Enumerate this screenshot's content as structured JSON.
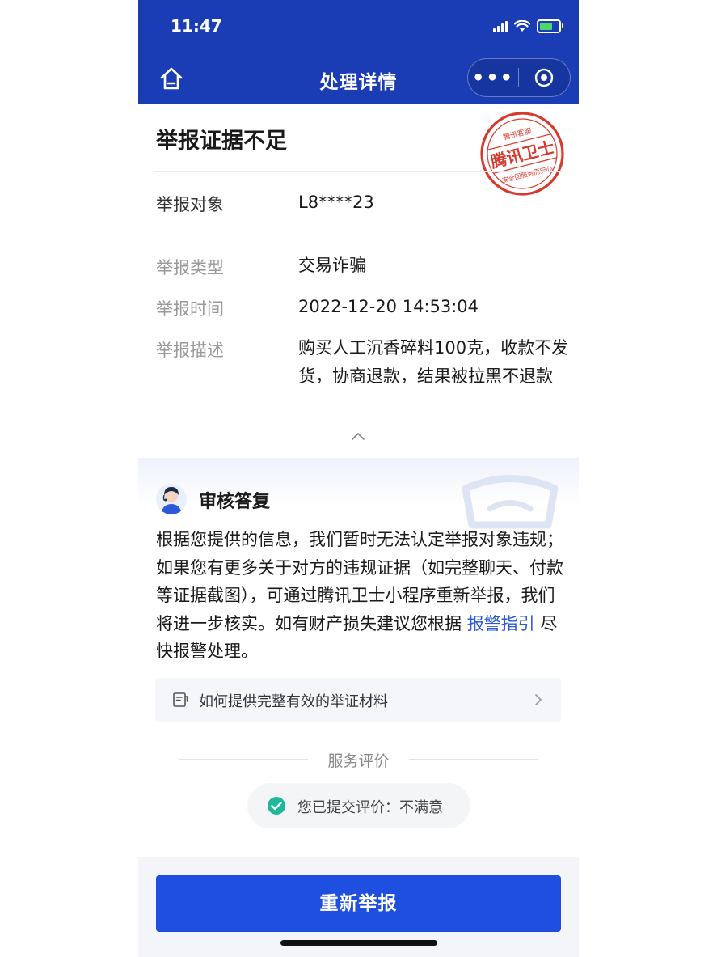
{
  "status_bar": {
    "time": "11:47",
    "battery_level": 0.85,
    "battery_color": "#4cd964"
  },
  "nav": {
    "title": "处理详情",
    "more_label": "•••"
  },
  "report": {
    "title": "举报证据不足",
    "stamp": {
      "main_text": "腾讯卫士",
      "top_text": "腾讯客服",
      "bottom_text": "安全回服务而安心",
      "color": "#d9382c"
    },
    "target_label": "举报对象",
    "target_value": "L8****23",
    "type_label": "举报类型",
    "type_value": "交易诈骗",
    "time_label": "举报时间",
    "time_value": "2022-12-20 14:53:04",
    "desc_label": "举报描述",
    "desc_value": "购买人工沉香碎料100克，收款不发货，协商退款，结果被拉黑不退款"
  },
  "review": {
    "title": "审核答复",
    "text_before_link": "根据您提供的信息，我们暂时无法认定举报对象违规；如果您有更多关于对方的违规证据（如完整聊天、付款等证据截图），可通过腾讯卫士小程序重新举报，我们将进一步核实。如有财产损失建议您根据 ",
    "link_text": "报警指引",
    "text_after_link": " 尽快报警处理。",
    "guide_text": "如何提供完整有效的举证材料",
    "rating_title": "服务评价",
    "rating_text": "您已提交评价：不满意"
  },
  "bottom": {
    "resubmit_label": "重新举报"
  },
  "colors": {
    "nav_bg": "#1a3db5",
    "primary_button": "#1f4fe0",
    "link": "#2b59d9",
    "check": "#1fb89a"
  }
}
